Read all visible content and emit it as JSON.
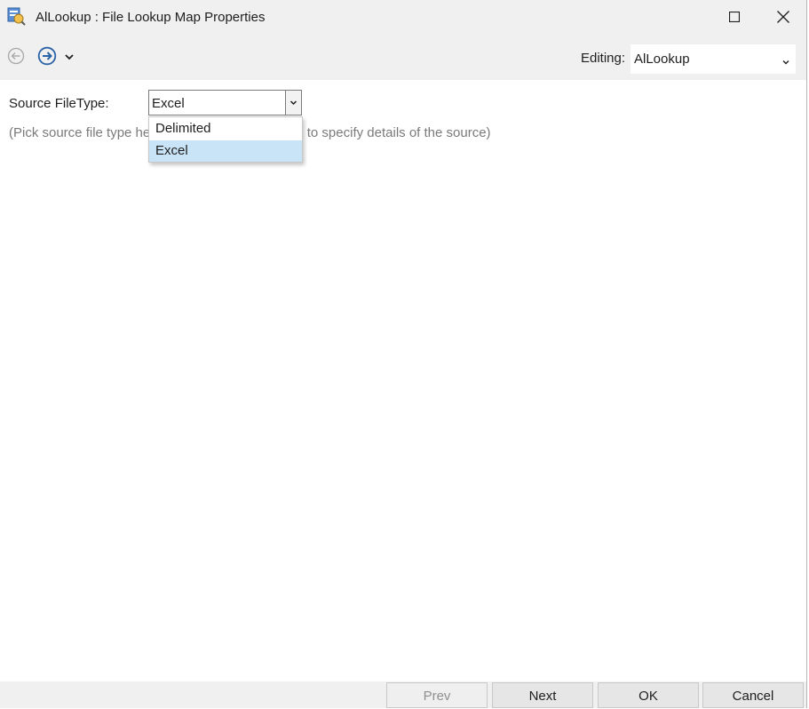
{
  "window": {
    "title": "AlLookup : File Lookup Map Properties",
    "icons": [
      "app-icon",
      "maximize-icon",
      "close-icon"
    ]
  },
  "toolbar": {
    "back_icon": "arrow-left-circle-icon",
    "forward_icon": "arrow-right-circle-icon",
    "history_dropdown_icon": "chevron-down-icon",
    "editing_label": "Editing:",
    "editing_value": "AlLookup"
  },
  "form": {
    "source_filetype_label": "Source FileType:",
    "source_filetype_value": "Excel",
    "hint_visible_left": "(Pick source file type he",
    "hint_visible_right": "e to specify details of the source)",
    "dropdown_options": [
      "Delimited",
      "Excel"
    ],
    "dropdown_selected": "Excel"
  },
  "footer": {
    "prev_label": "Prev",
    "next_label": "Next",
    "ok_label": "OK",
    "cancel_label": "Cancel"
  },
  "colors": {
    "chrome_bg": "#f0f0f0",
    "selection_bg": "#c9e4f7",
    "hint_text": "#7a7a7a",
    "forward_icon": "#2b63a8"
  }
}
